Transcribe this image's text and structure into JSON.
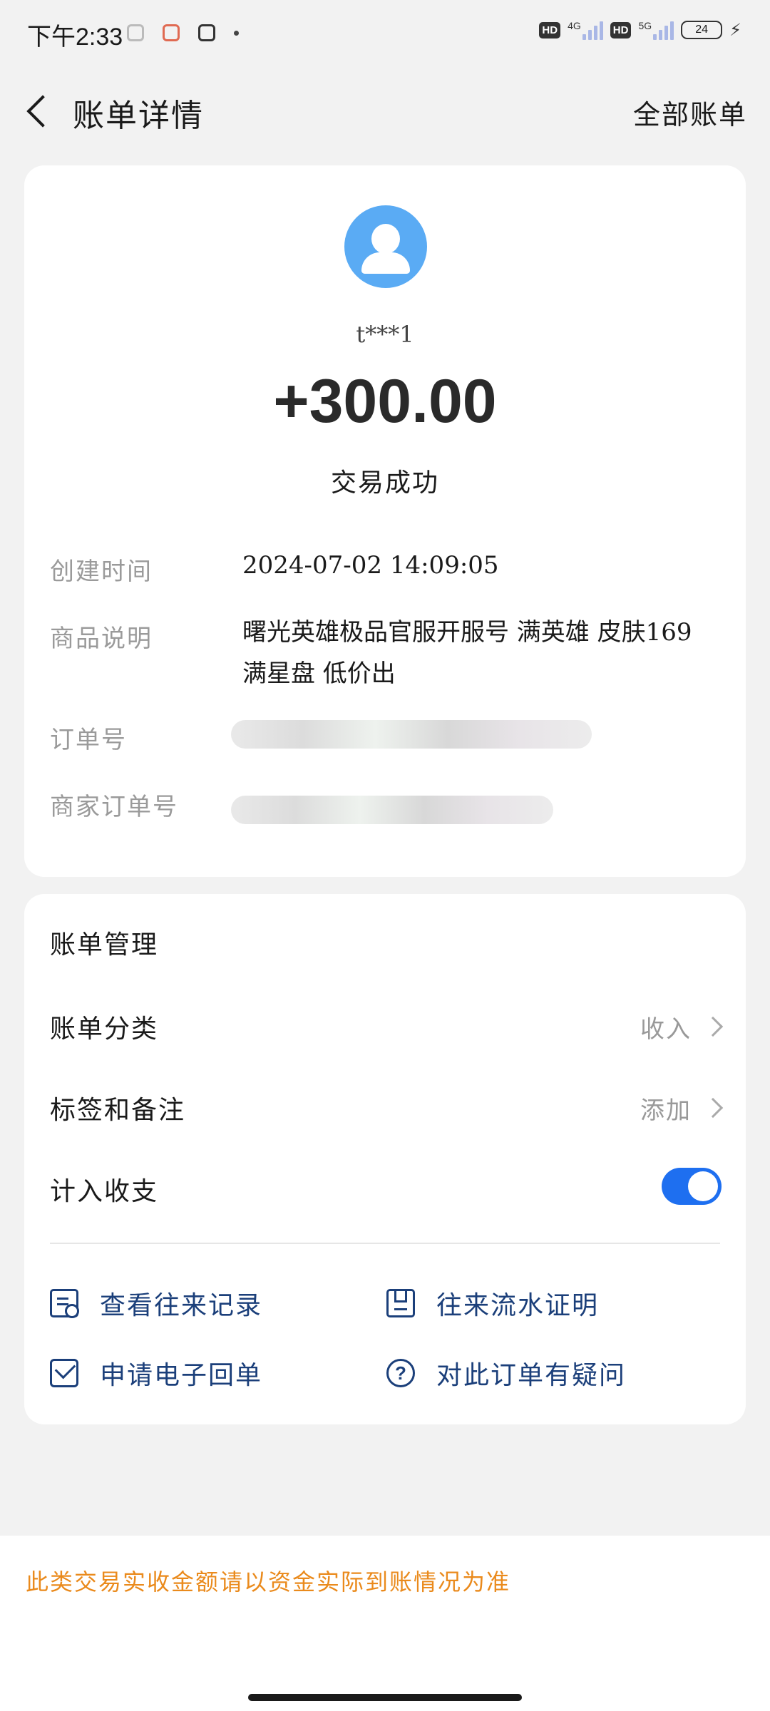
{
  "status_bar": {
    "time": "下午2:33",
    "network1": "4G",
    "network2": "5G",
    "hd_label": "HD",
    "battery": "24"
  },
  "header": {
    "title": "账单详情",
    "all_bills": "全部账单"
  },
  "transaction": {
    "username": "t***1",
    "amount": "+300.00",
    "status": "交易成功",
    "created_label": "创建时间",
    "created_value": "2024-07-02  14:09:05",
    "product_label": "商品说明",
    "product_value": "曙光英雄极品官服开服号 满英雄 皮肤169 满星盘 低价出",
    "order_label": "订单号",
    "merchant_order_label": "商家订单号"
  },
  "management": {
    "title": "账单管理",
    "category_label": "账单分类",
    "category_value": "收入",
    "tags_label": "标签和备注",
    "tags_value": "添加",
    "include_label": "计入收支",
    "include_enabled": true
  },
  "actions": {
    "view_records": "查看往来记录",
    "flow_proof": "往来流水证明",
    "e_receipt": "申请电子回单",
    "question": "对此订单有疑问"
  },
  "footer": {
    "notice": "此类交易实收金额请以资金实际到账情况为准"
  },
  "colors": {
    "accent": "#1e6ff0",
    "avatar": "#5aabf4",
    "action_text": "#1b3f7a",
    "notice": "#ea8a1c"
  }
}
